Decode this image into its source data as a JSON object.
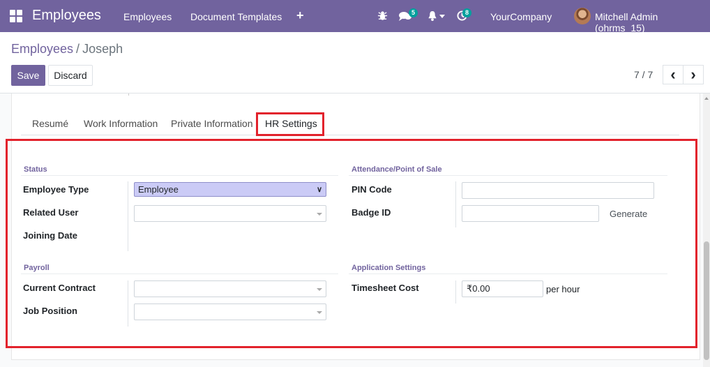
{
  "navbar": {
    "app_title": "Employees",
    "menus": [
      "Employees",
      "Document Templates"
    ],
    "add_symbol": "+",
    "messages_badge": "5",
    "activity_badge": "8",
    "company": "YourCompany",
    "user": "Mitchell Admin (ohrms_15)",
    "background_color": "#71639e"
  },
  "breadcrumb": {
    "root": "Employees",
    "separator": "/",
    "current": "Joseph"
  },
  "actions": {
    "save_label": "Save",
    "discard_label": "Discard"
  },
  "pager": {
    "value": "7 / 7",
    "prev_symbol": "‹",
    "next_symbol": "›"
  },
  "tabs": {
    "items": [
      "Resumé",
      "Work Information",
      "Private Information",
      "HR Settings"
    ],
    "active": "HR Settings"
  },
  "status_group": {
    "title": "Status",
    "employee_type_label": "Employee Type",
    "employee_type_value": "Employee",
    "related_user_label": "Related User",
    "joining_date_label": "Joining Date"
  },
  "attendance_group": {
    "title": "Attendance/Point of Sale",
    "pin_label": "PIN Code",
    "badge_label": "Badge ID",
    "generate_label": "Generate"
  },
  "payroll_group": {
    "title": "Payroll",
    "contract_label": "Current Contract",
    "job_position_label": "Job Position"
  },
  "application_group": {
    "title": "Application Settings",
    "timesheet_label": "Timesheet Cost",
    "timesheet_value": "₹0.00",
    "unit": "per hour"
  },
  "colors": {
    "accent": "#71639e",
    "highlight": "#e2222c",
    "badge": "#00a09d"
  }
}
